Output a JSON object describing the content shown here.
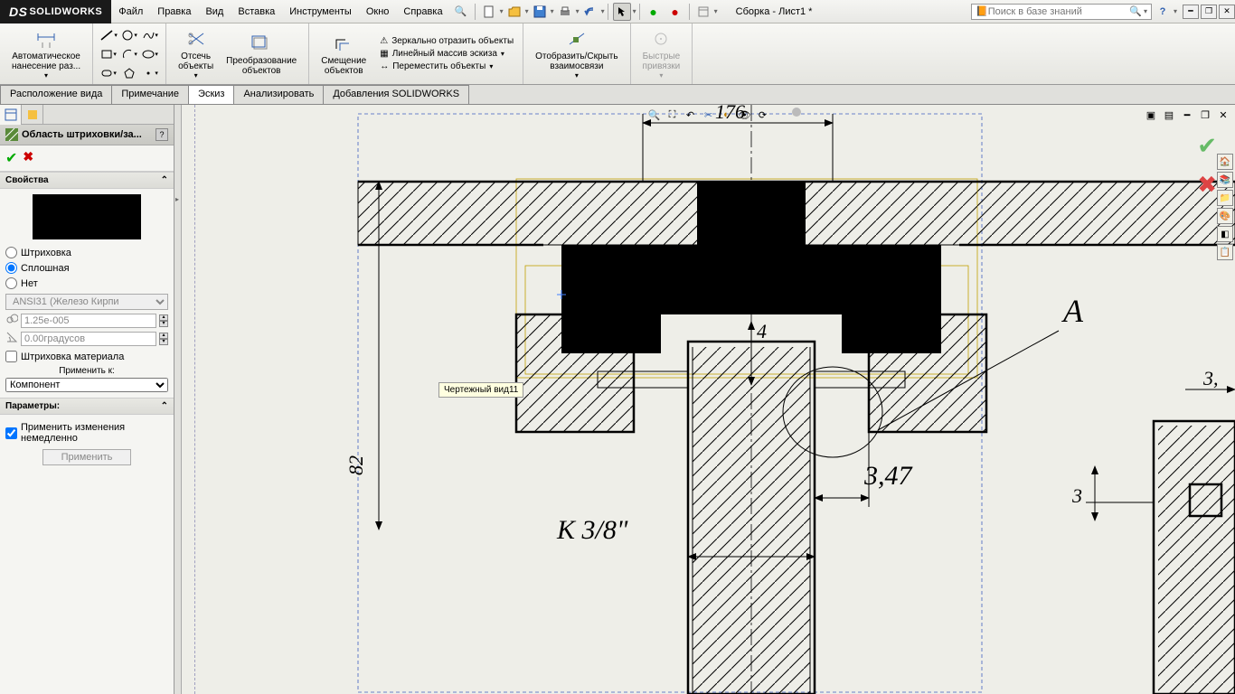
{
  "app": {
    "name": "SOLIDWORKS",
    "doc_title": "Сборка - Лист1 *"
  },
  "menu": {
    "file": "Файл",
    "edit": "Правка",
    "view": "Вид",
    "insert": "Вставка",
    "tools": "Инструменты",
    "window": "Окно",
    "help": "Справка"
  },
  "search": {
    "placeholder": "Поиск в базе знаний"
  },
  "ribbon": {
    "auto_dim": "Автоматическое\nнанесение раз...",
    "trim": "Отсечь\nобъекты",
    "convert": "Преобразование\nобъектов",
    "offset": "Смещение\nобъектов",
    "mirror": "Зеркально отразить объекты",
    "linear": "Линейный массив эскиза",
    "move": "Переместить объекты",
    "showhide": "Отобразить/Скрыть\nвзаимосвязи",
    "snaps": "Быстрые\nпривязки"
  },
  "tabs": {
    "layout": "Расположение вида",
    "annotate": "Примечание",
    "sketch": "Эскиз",
    "analyze": "Анализировать",
    "addins": "Добавления SOLIDWORKS"
  },
  "panel": {
    "title": "Область штриховки/за...",
    "props": "Свойства",
    "hatch": "Штриховка",
    "solid": "Сплошная",
    "none": "Нет",
    "pattern": "ANSI31 (Железо Кирпи",
    "scale": "1.25e-005",
    "angle": "0.00градусов",
    "material_hatch": "Штриховка материала",
    "apply_to": "Применить к:",
    "apply_to_val": "Компонент",
    "params": "Параметры:",
    "apply_immediate": "Применить изменения немедленно",
    "apply_btn": "Применить"
  },
  "canvas": {
    "tooltip": "Чертежный вид11",
    "dims": {
      "d1": "176",
      "d2": "4",
      "d3": "82",
      "d4": "3,47",
      "d5": "K 3/8\"",
      "d6": "3",
      "d7": "3,",
      "label_a": "A"
    }
  }
}
